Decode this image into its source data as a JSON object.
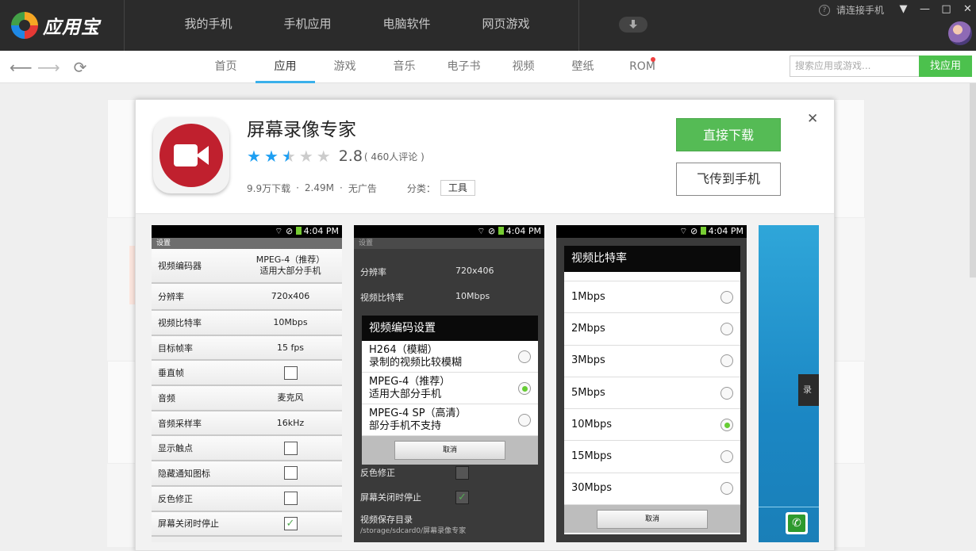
{
  "app": {
    "name": "应用宝"
  },
  "top_nav": [
    "我的手机",
    "手机应用",
    "电脑软件",
    "网页游戏"
  ],
  "status": {
    "connect": "请连接手机"
  },
  "window_controls": {
    "menu": "▼",
    "minimize": "—",
    "maximize": "□",
    "close": "✕"
  },
  "sub_tabs": [
    {
      "label": "首页"
    },
    {
      "label": "应用",
      "active": true
    },
    {
      "label": "游戏"
    },
    {
      "label": "音乐"
    },
    {
      "label": "电子书"
    },
    {
      "label": "视频"
    },
    {
      "label": "壁纸"
    },
    {
      "label": "ROM",
      "badge": true
    }
  ],
  "search": {
    "placeholder": "搜索应用或游戏...",
    "button": "找应用"
  },
  "detail": {
    "name": "屏幕录像专家",
    "rating": 2.5,
    "score": "2.8",
    "review_count": "( 460人评论 )",
    "downloads": "9.9万下载",
    "size": "2.49M",
    "ads": "无广告",
    "category_label": "分类：",
    "category": "工具",
    "download_button": "直接下载",
    "send_button": "飞传到手机",
    "close": "✕"
  },
  "screenshots": {
    "time": "4:04 PM",
    "shot1": {
      "header": "设置",
      "rows": [
        {
          "k": "视频编码器",
          "v": "MPEG-4（推荐）\n适用大部分手机",
          "tall": true
        },
        {
          "k": "分辨率",
          "v": "720x406"
        },
        {
          "k": "视频比特率",
          "v": "10Mbps"
        },
        {
          "k": "目标帧率",
          "v": "15 fps"
        },
        {
          "k": "垂直帧",
          "cb": false
        },
        {
          "k": "音频",
          "v": "麦克风"
        },
        {
          "k": "音频采样率",
          "v": "16kHz"
        },
        {
          "k": "显示触点",
          "cb": false
        },
        {
          "k": "隐藏通知图标",
          "cb": false
        },
        {
          "k": "反色修正",
          "cb": false
        },
        {
          "k": "屏幕关闭时停止",
          "cb": true
        }
      ]
    },
    "shot2": {
      "header": "设置",
      "bg_rows": [
        {
          "k": "分辨率",
          "v": "720x406"
        },
        {
          "k": "视频比特率",
          "v": "10Mbps"
        },
        {
          "k": "反色修正",
          "v": ""
        },
        {
          "k": "屏幕关闭时停止",
          "v": ""
        }
      ],
      "save_title": "视频保存目录",
      "save_path": "/storage/sdcard0/屏幕录像专家",
      "dialog_title": "视频编码设置",
      "options": [
        {
          "label": "H264（模糊）\n录制的视频比较模糊",
          "selected": false
        },
        {
          "label": "MPEG-4（推荐）\n适用大部分手机",
          "selected": true
        },
        {
          "label": "MPEG-4 SP（高清）\n部分手机不支持",
          "selected": false
        }
      ],
      "cancel": "取消"
    },
    "shot3": {
      "dialog_title": "视频比特率",
      "options": [
        {
          "label": "1Mbps",
          "selected": false
        },
        {
          "label": "2Mbps",
          "selected": false
        },
        {
          "label": "3Mbps",
          "selected": false
        },
        {
          "label": "5Mbps",
          "selected": false
        },
        {
          "label": "10Mbps",
          "selected": true
        },
        {
          "label": "15Mbps",
          "selected": false
        },
        {
          "label": "30Mbps",
          "selected": false
        }
      ],
      "cancel": "取消"
    },
    "shot4": {
      "side_label": "录"
    }
  }
}
